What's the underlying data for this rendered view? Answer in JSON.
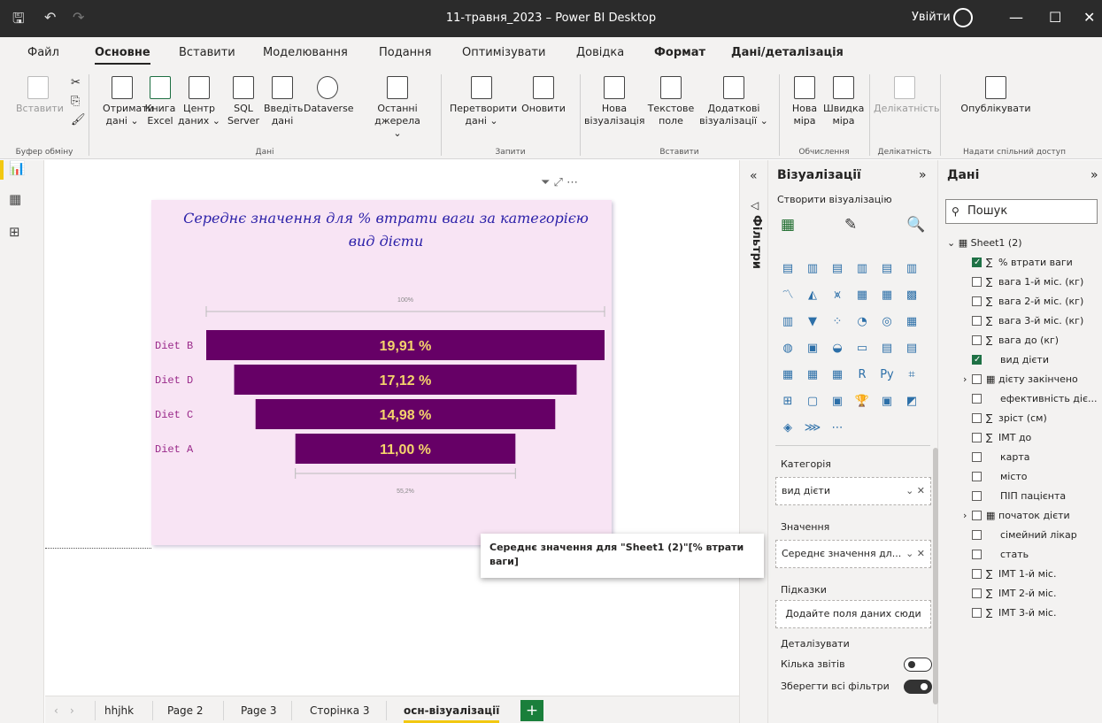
{
  "window": {
    "title": "11-травня_2023 – Power BI Desktop",
    "signin": "Увійти"
  },
  "menu": [
    "Файл",
    "Основне",
    "Вставити",
    "Моделювання",
    "Подання",
    "Оптимізувати",
    "Довідка",
    "Формат",
    "Дані/деталізація"
  ],
  "ribbon": {
    "paste": "Вставити",
    "get_data": "Отримати дані ⌄",
    "excel": "Книга Excel",
    "hub": "Центр даних ⌄",
    "sql": "SQL Server",
    "enter": "Введіть дані",
    "dataverse": "Dataverse",
    "recent": "Останні джерела ⌄",
    "transform": "Перетворити дані ⌄",
    "refresh": "Оновити",
    "newvis": "Нова візуалізація",
    "textbox": "Текстове поле",
    "morevis": "Додаткові візуалізації ⌄",
    "newmeasure": "Нова міра",
    "quickmeasure": "Швидка міра",
    "sensitivity": "Делікатність",
    "publish": "Опублікувати",
    "groups": [
      "Буфер обміну",
      "Дані",
      "Запити",
      "Вставити",
      "Обчислення",
      "Делікатність",
      "Надати спільний доступ"
    ]
  },
  "visual": {
    "title": "Середнє значення для % втрати ваги за категорією вид дієти",
    "top_pct": "100%",
    "bottom_pct": "55,2%"
  },
  "chart_data": {
    "type": "funnel",
    "categories": [
      "Diet B",
      "Diet D",
      "Diet C",
      "Diet A"
    ],
    "values": [
      19.91,
      17.12,
      14.98,
      11.0
    ],
    "labels": [
      "19,91 %",
      "17,12 %",
      "14,98 %",
      "11,00 %"
    ],
    "bar_color": "#660066",
    "label_color": "#f5d36c"
  },
  "tabs": [
    "hhjhk",
    "Page 2",
    "Page 3",
    "Сторінка 3",
    "осн-візуалізації"
  ],
  "filters_label": "Фільтри",
  "viz": {
    "title": "Візуалізації",
    "build": "Створити візуалізацію",
    "category_label": "Категорія",
    "category_value": "вид дієти",
    "values_label": "Значення",
    "values_value": "Середнє значення дл...",
    "tooltips_label": "Підказки",
    "tooltips_placeholder": "Додайте поля даних сюди",
    "drill_label": "Деталізувати",
    "cross_report": "Кілька звітів",
    "keep_filters": "Зберегти всі фільтри"
  },
  "data_pane": {
    "title": "Дані",
    "search_placeholder": "Пошук",
    "table": "Sheet1 (2)",
    "fields": [
      {
        "name": "% втрати ваги",
        "checked": true,
        "sigma": true
      },
      {
        "name": "вага 1-й міс. (кг)",
        "checked": false,
        "sigma": true
      },
      {
        "name": "вага 2-й міс. (кг)",
        "checked": false,
        "sigma": true
      },
      {
        "name": "вага 3-й міс. (кг)",
        "checked": false,
        "sigma": true
      },
      {
        "name": "вага до (кг)",
        "checked": false,
        "sigma": true
      },
      {
        "name": "вид дієти",
        "checked": true,
        "sigma": false
      },
      {
        "name": "дієту закінчено",
        "checked": false,
        "sigma": false,
        "date": true
      },
      {
        "name": "ефективність діє...",
        "checked": false,
        "sigma": false
      },
      {
        "name": "зріст (см)",
        "checked": false,
        "sigma": true
      },
      {
        "name": "ІМТ до",
        "checked": false,
        "sigma": true
      },
      {
        "name": "карта",
        "checked": false,
        "sigma": false
      },
      {
        "name": "місто",
        "checked": false,
        "sigma": false
      },
      {
        "name": "ПІП пацієнта",
        "checked": false,
        "sigma": false
      },
      {
        "name": "початок дієти",
        "checked": false,
        "sigma": false,
        "date": true
      },
      {
        "name": "сімейний лікар",
        "checked": false,
        "sigma": false
      },
      {
        "name": "стать",
        "checked": false,
        "sigma": false
      },
      {
        "name": "ІМТ 1-й міс.",
        "checked": false,
        "sigma": true
      },
      {
        "name": "ІМТ 2-й міс.",
        "checked": false,
        "sigma": true
      },
      {
        "name": "ІМТ 3-й міс.",
        "checked": false,
        "sigma": true
      }
    ]
  },
  "tooltip": "Середнє значення для \"Sheet1 (2)\"[% втрати ваги]"
}
